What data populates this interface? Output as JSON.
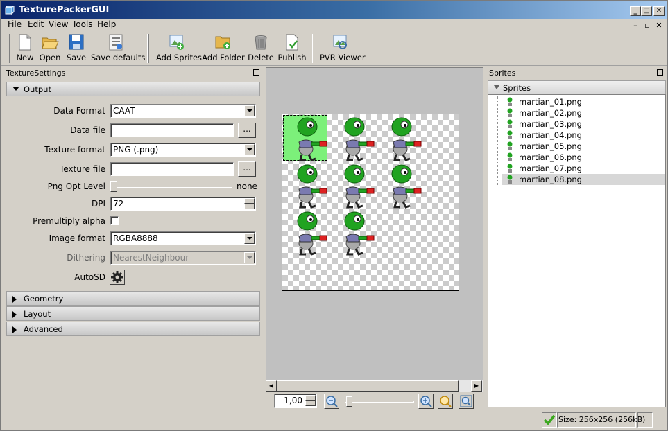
{
  "window": {
    "title": "TexturePackerGUI"
  },
  "menu": {
    "items": [
      "File",
      "Edit",
      "View",
      "Tools",
      "Help"
    ]
  },
  "toolbar": {
    "new_label": "New",
    "open_label": "Open",
    "save_label": "Save",
    "save_defaults_label": "Save defaults",
    "add_sprites_label": "Add Sprites",
    "add_folder_label": "Add Folder",
    "delete_label": "Delete",
    "publish_label": "Publish",
    "pvr_viewer_label": "PVR Viewer"
  },
  "settings": {
    "panel_title": "TextureSettings",
    "output_section": "Output",
    "data_format_label": "Data Format",
    "data_format_value": "CAAT",
    "data_file_label": "Data file",
    "data_file_value": "",
    "texture_format_label": "Texture format",
    "texture_format_value": "PNG (.png)",
    "texture_file_label": "Texture file",
    "texture_file_value": "",
    "browse_label": "...",
    "png_opt_label": "Png Opt Level",
    "png_opt_value": "none",
    "png_opt_level_fraction": 0,
    "dpi_label": "DPI",
    "dpi_value": "72",
    "premultiply_label": "Premultiply alpha",
    "premultiply_checked": false,
    "image_format_label": "Image format",
    "image_format_value": "RGBA8888",
    "dithering_label": "Dithering",
    "dithering_value": "NearestNeighbour",
    "autosd_label": "AutoSD",
    "geometry_section": "Geometry",
    "layout_section": "Layout",
    "advanced_section": "Advanced"
  },
  "canvas": {
    "zoom_value": "1,00",
    "zoom_fraction": 0.02
  },
  "sprites_panel": {
    "panel_title": "Sprites",
    "tree_root": "Sprites",
    "items": [
      {
        "name": "martian_01.png"
      },
      {
        "name": "martian_02.png"
      },
      {
        "name": "martian_03.png"
      },
      {
        "name": "martian_04.png"
      },
      {
        "name": "martian_05.png"
      },
      {
        "name": "martian_06.png"
      },
      {
        "name": "martian_07.png"
      },
      {
        "name": "martian_08.png"
      }
    ],
    "selected_index": 7
  },
  "status": {
    "size_text": "Size: 256x256 (256kB)"
  },
  "colors": {
    "title_start": "#0a246a",
    "title_end": "#a6caf0",
    "selection": "#7cf07a",
    "sprite_green": "#21a321"
  }
}
